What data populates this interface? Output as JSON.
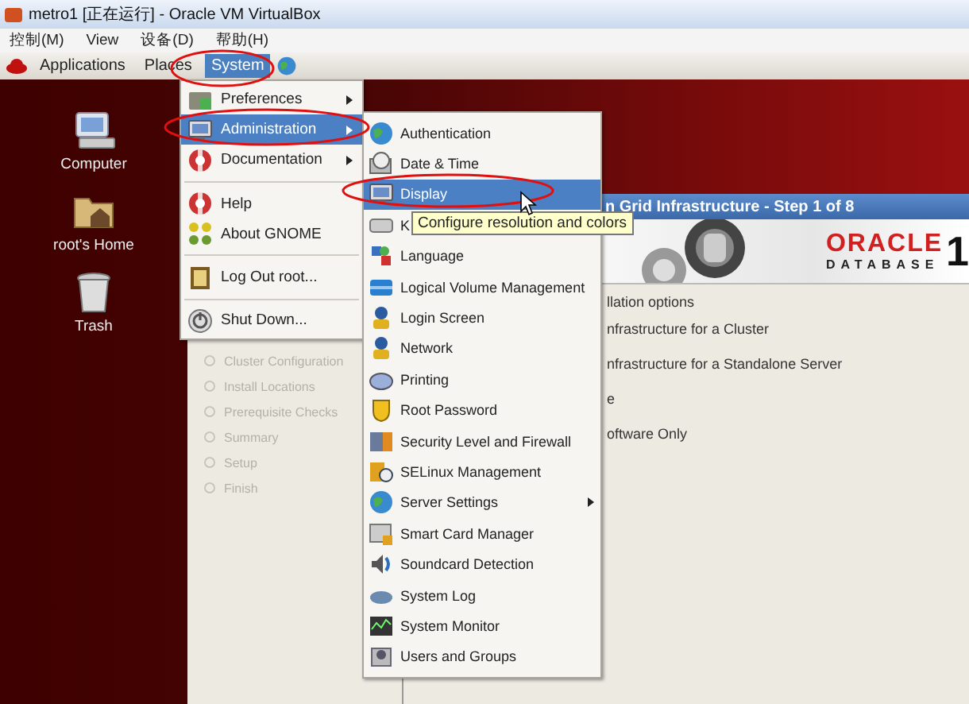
{
  "window": {
    "title": "metro1 [正在运行] - Oracle VM VirtualBox"
  },
  "menu_bar": [
    "控制(M)",
    "View",
    "设备(D)",
    "帮助(H)"
  ],
  "panel": {
    "menus": [
      {
        "label": "Applications",
        "selected": false
      },
      {
        "label": "Places",
        "selected": false
      },
      {
        "label": "System",
        "selected": true
      }
    ]
  },
  "desktop_icons": [
    "Computer",
    "root's Home",
    "Trash"
  ],
  "system_menu": [
    {
      "kind": "item",
      "label": "Preferences",
      "submenu": true,
      "selected": false
    },
    {
      "kind": "item",
      "label": "Administration",
      "submenu": true,
      "selected": true
    },
    {
      "kind": "item",
      "label": "Documentation",
      "submenu": true,
      "selected": false
    },
    {
      "kind": "separator"
    },
    {
      "kind": "item",
      "label": "Help",
      "submenu": false,
      "selected": false
    },
    {
      "kind": "item",
      "label": "About GNOME",
      "submenu": false,
      "selected": false
    },
    {
      "kind": "separator"
    },
    {
      "kind": "item",
      "label": "Log Out root...",
      "submenu": false,
      "selected": false
    },
    {
      "kind": "separator"
    },
    {
      "kind": "item",
      "label": "Shut Down...",
      "submenu": false,
      "selected": false
    }
  ],
  "administration_menu": [
    {
      "label": "Authentication",
      "submenu": false,
      "selected": false
    },
    {
      "label": "Date & Time",
      "submenu": false,
      "selected": false
    },
    {
      "label": "Display",
      "submenu": false,
      "selected": true
    },
    {
      "label": "K",
      "selected": false
    },
    {
      "label": "Language",
      "submenu": false,
      "selected": false
    },
    {
      "label": "Logical Volume Management",
      "submenu": false,
      "selected": false
    },
    {
      "label": "Login Screen",
      "submenu": false,
      "selected": false
    },
    {
      "label": "Network",
      "submenu": false,
      "selected": false
    },
    {
      "label": "Printing",
      "submenu": false,
      "selected": false
    },
    {
      "label": "Root Password",
      "submenu": false,
      "selected": false
    },
    {
      "label": "Security Level and Firewall",
      "submenu": false,
      "selected": false
    },
    {
      "label": "SELinux Management",
      "submenu": false,
      "selected": false
    },
    {
      "label": "Server Settings",
      "submenu": true,
      "selected": false
    },
    {
      "label": "Smart Card Manager",
      "submenu": false,
      "selected": false
    },
    {
      "label": "Soundcard Detection",
      "submenu": false,
      "selected": false
    },
    {
      "label": "System Log",
      "submenu": false,
      "selected": false
    },
    {
      "label": "System Monitor",
      "submenu": false,
      "selected": false
    },
    {
      "label": "Users and Groups",
      "submenu": false,
      "selected": false
    }
  ],
  "tooltip": "Configure resolution and colors",
  "installer": {
    "title": "n Grid Infrastructure - Step 1 of 8",
    "logo": {
      "brand": "ORACLE",
      "product": "DATABASE",
      "version": "1"
    },
    "steps": [
      "Cluster Configuration",
      "Install Locations",
      "Prerequisite Checks",
      "Summary",
      "Setup",
      "Finish"
    ],
    "heading": "llation options",
    "options": [
      "nfrastructure for a Cluster",
      "nfrastructure for a Standalone Server",
      "e",
      "oftware Only"
    ]
  }
}
